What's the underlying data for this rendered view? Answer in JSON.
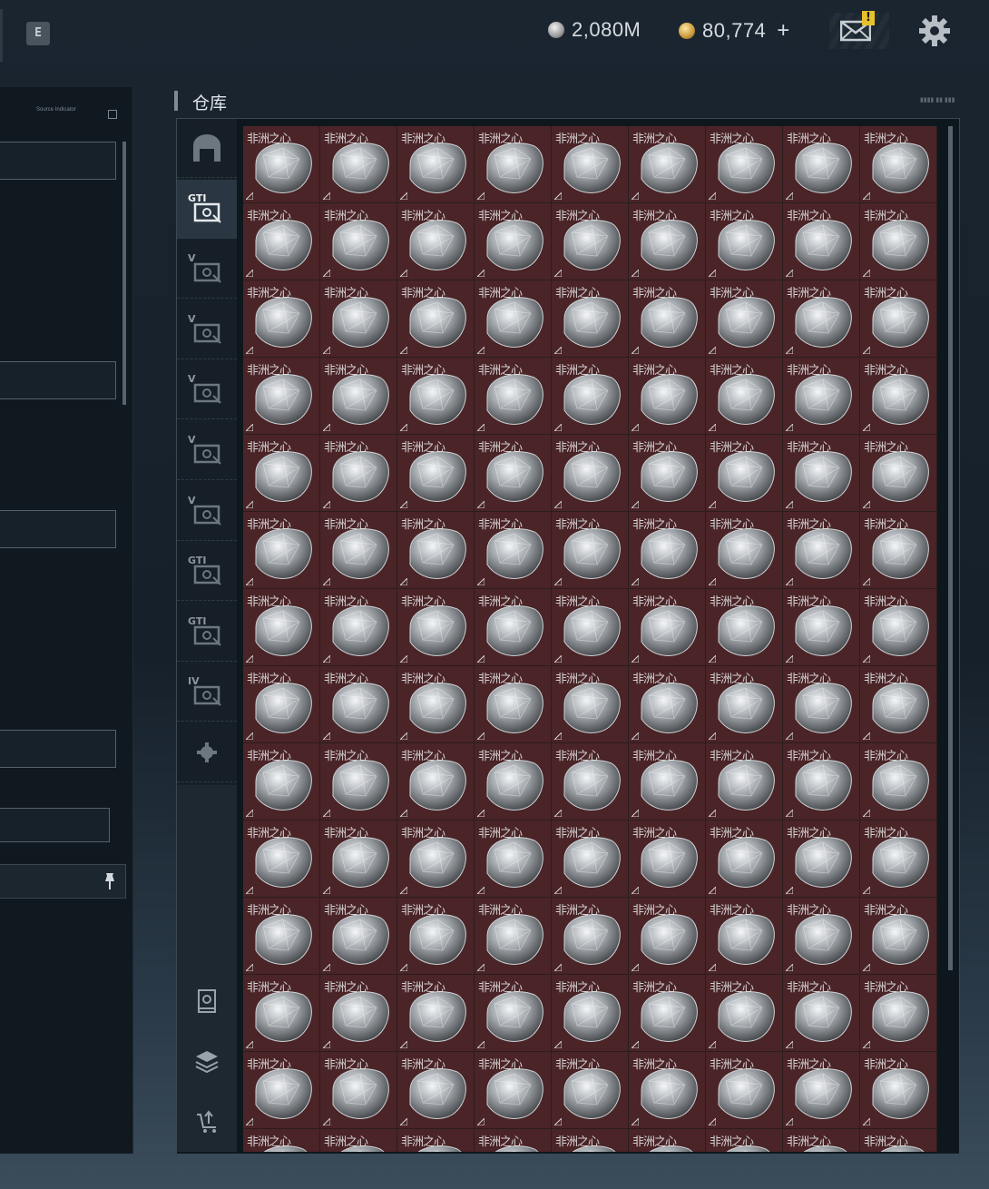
{
  "topbar": {
    "hotkey": "E",
    "currency_silver": "2,080M",
    "currency_gold": "80,774",
    "add_label": "+",
    "mail_alert": "!"
  },
  "left_panel": {
    "header_text": "Source Indicator"
  },
  "warehouse": {
    "title": "仓库",
    "tabs": [
      {
        "icon": "warehouse-icon",
        "badge": ""
      },
      {
        "icon": "gti-case-icon",
        "badge": "GTI"
      },
      {
        "icon": "v-case-icon",
        "badge": "V"
      },
      {
        "icon": "v-case-icon",
        "badge": "V"
      },
      {
        "icon": "v-case-icon",
        "badge": "V"
      },
      {
        "icon": "v-case-icon",
        "badge": "V"
      },
      {
        "icon": "v-case-icon",
        "badge": "V"
      },
      {
        "icon": "gti-bag-icon",
        "badge": "GTI"
      },
      {
        "icon": "gti-box-icon",
        "badge": "GTI"
      },
      {
        "icon": "iv-box-icon",
        "badge": "IV"
      },
      {
        "icon": "gear-icon",
        "badge": ""
      }
    ],
    "bottom_tools": [
      "inspect-icon",
      "stack-icon",
      "sell-icon"
    ],
    "item_name": "非洲之心",
    "columns": 9,
    "rows": 13
  }
}
